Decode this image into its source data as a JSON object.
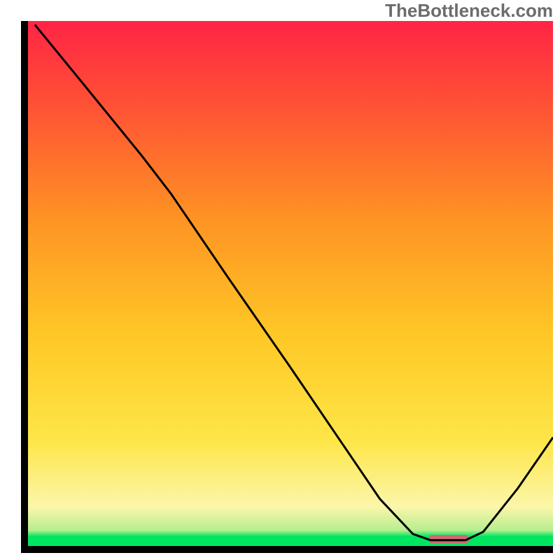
{
  "watermark": "TheBottleneck.com",
  "chart_data": {
    "type": "line",
    "title": "",
    "xlabel": "",
    "ylabel": "",
    "xlim": [
      0,
      100
    ],
    "ylim": [
      0,
      100
    ],
    "grid": false,
    "legend": false,
    "note": "Axes are unlabeled in the source image; x and y values are read as percentages of the plotting area (0 = left/bottom, 100 = right/top).",
    "series": [
      {
        "name": "curve",
        "color": "#000000",
        "points": [
          {
            "x": 1.3,
            "y": 99.3
          },
          {
            "x": 10.3,
            "y": 88.3
          },
          {
            "x": 21.7,
            "y": 74.3
          },
          {
            "x": 27.3,
            "y": 67.0
          },
          {
            "x": 38.0,
            "y": 51.3
          },
          {
            "x": 50.0,
            "y": 34.0
          },
          {
            "x": 60.0,
            "y": 19.3
          },
          {
            "x": 67.0,
            "y": 9.0
          },
          {
            "x": 73.3,
            "y": 2.3
          },
          {
            "x": 76.7,
            "y": 1.1
          },
          {
            "x": 83.3,
            "y": 1.1
          },
          {
            "x": 86.7,
            "y": 2.7
          },
          {
            "x": 93.3,
            "y": 11.0
          },
          {
            "x": 100.0,
            "y": 20.7
          }
        ]
      }
    ],
    "marker": {
      "name": "highlight-bar",
      "color": "#cf6a6f",
      "x_start": 76.3,
      "x_end": 84.0,
      "y": 1.3,
      "height_pct": 1.6
    },
    "background_gradient": {
      "stops": [
        {
          "pos": 0.0,
          "color": "#00e55f"
        },
        {
          "pos": 0.018,
          "color": "#00e560"
        },
        {
          "pos": 0.03,
          "color": "#b7ee8f"
        },
        {
          "pos": 0.075,
          "color": "#fbf6aa"
        },
        {
          "pos": 0.2,
          "color": "#fee648"
        },
        {
          "pos": 0.4,
          "color": "#fec826"
        },
        {
          "pos": 0.62,
          "color": "#fe9423"
        },
        {
          "pos": 0.82,
          "color": "#ff5733"
        },
        {
          "pos": 1.0,
          "color": "#ff2445"
        }
      ]
    }
  }
}
